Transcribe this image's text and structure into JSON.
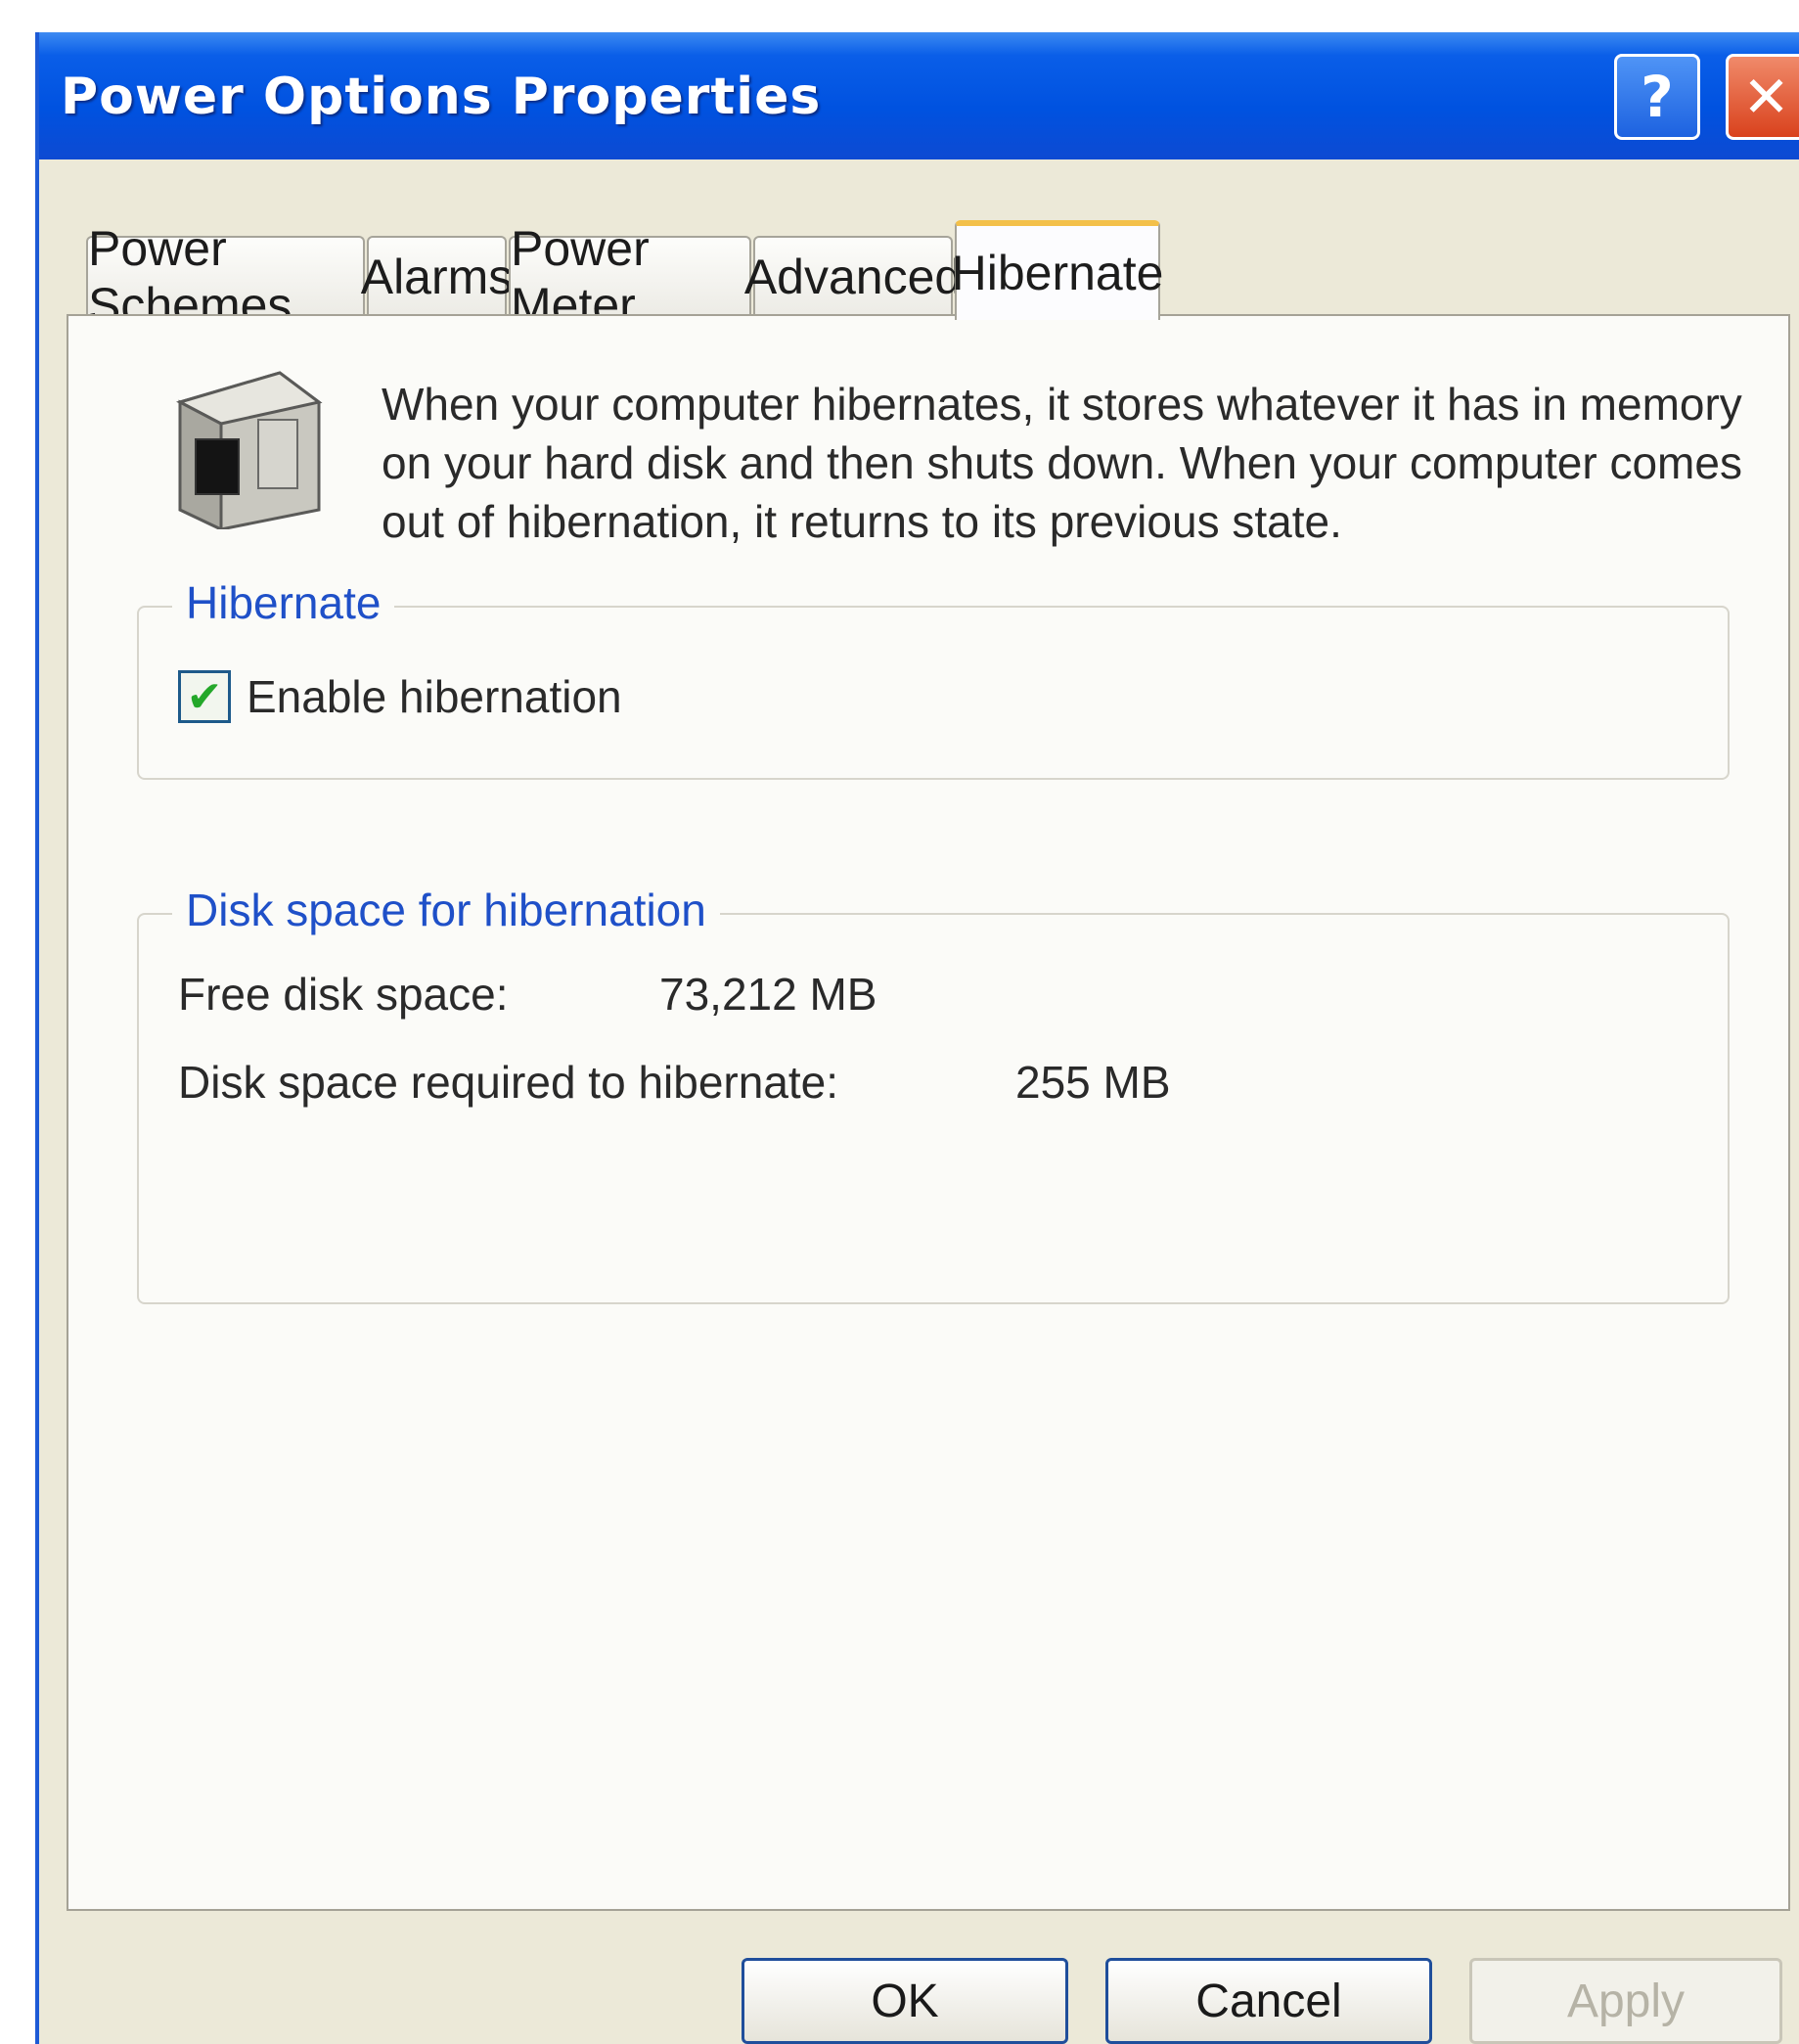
{
  "window": {
    "title": "Power Options Properties",
    "help_label": "?",
    "close_label": "✕"
  },
  "tabs": [
    {
      "label": "Power Schemes",
      "active": false
    },
    {
      "label": "Alarms",
      "active": false
    },
    {
      "label": "Power Meter",
      "active": false
    },
    {
      "label": "Advanced",
      "active": false
    },
    {
      "label": "Hibernate",
      "active": true
    }
  ],
  "hibernate_page": {
    "description": "When your computer hibernates, it stores whatever it has in memory on your hard disk and then shuts down. When your computer comes out of hibernation, it returns to its previous state.",
    "group_hibernate": {
      "legend": "Hibernate",
      "checkbox_label": "Enable hibernation",
      "checked": true
    },
    "group_disk": {
      "legend": "Disk space for hibernation",
      "free_label": "Free disk space:",
      "free_value": "73,212 MB",
      "required_label": "Disk space required to hibernate:",
      "required_value": "255 MB"
    }
  },
  "buttons": {
    "ok": "OK",
    "cancel": "Cancel",
    "apply": "Apply",
    "apply_enabled": false
  },
  "colors": {
    "titlebar": "#0052e0",
    "legend_text": "#1f50c8",
    "active_tab_highlight": "#f3c04a"
  }
}
